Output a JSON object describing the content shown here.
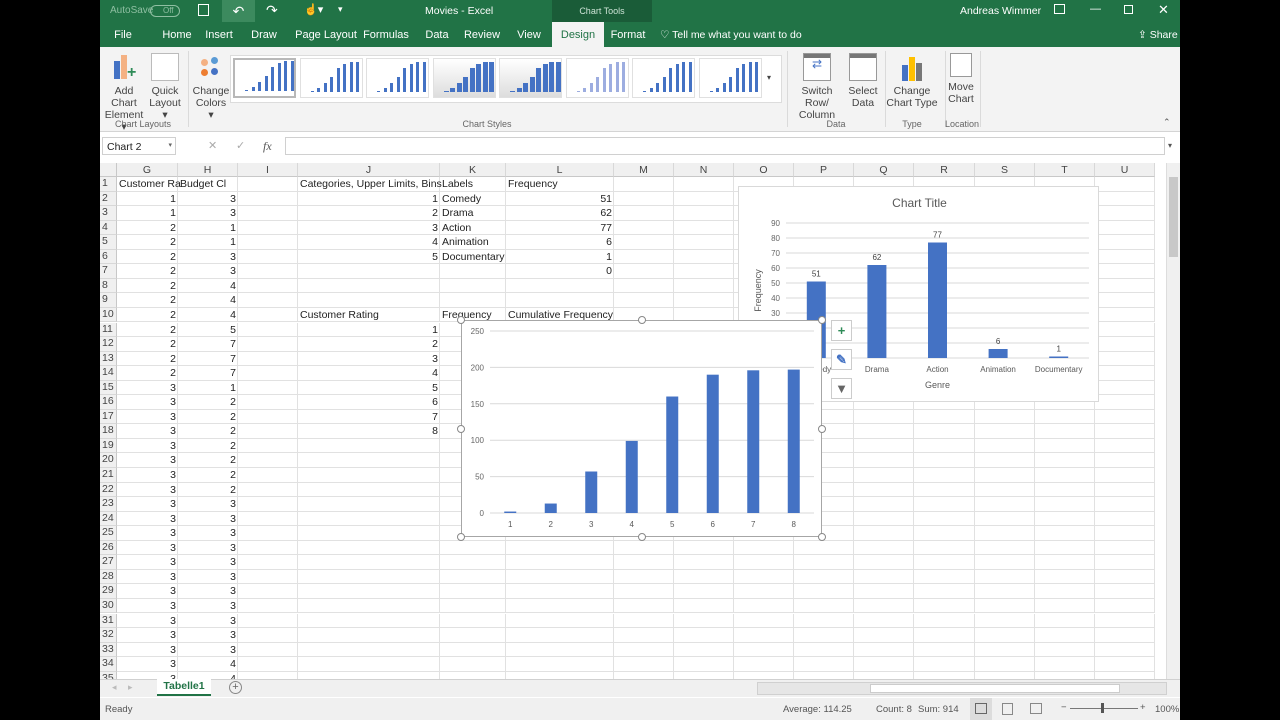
{
  "titlebar": {
    "autosave_label": "AutoSave",
    "autosave_state": "Off",
    "doc_title": "Movies  -  Excel",
    "context_tab_group": "Chart Tools",
    "user": "Andreas Wimmer"
  },
  "tabs": [
    {
      "label": "File"
    },
    {
      "label": "Home"
    },
    {
      "label": "Insert"
    },
    {
      "label": "Draw"
    },
    {
      "label": "Page Layout"
    },
    {
      "label": "Formulas"
    },
    {
      "label": "Data"
    },
    {
      "label": "Review"
    },
    {
      "label": "View"
    },
    {
      "label": "Design",
      "active": true
    },
    {
      "label": "Format"
    }
  ],
  "tell_me": "Tell me what you want to do",
  "share": "Share",
  "ribbon": {
    "add_chart_element": [
      "Add Chart",
      "Element ▾"
    ],
    "quick_layout": [
      "Quick",
      "Layout ▾"
    ],
    "change_colors": [
      "Change",
      "Colors ▾"
    ],
    "switch_row_column": [
      "Switch Row/",
      "Column"
    ],
    "select_data": [
      "Select",
      "Data"
    ],
    "change_chart_type": [
      "Change",
      "Chart Type"
    ],
    "move_chart": [
      "Move",
      "Chart"
    ],
    "groups": {
      "chart_layouts": "Chart Layouts",
      "chart_styles": "Chart Styles",
      "data": "Data",
      "type": "Type",
      "location": "Location"
    },
    "chart_style_count": 8,
    "accent": "#217346"
  },
  "formula_bar": {
    "name_box": "Chart 2",
    "cancel": "✕",
    "enter": "✓",
    "fx": "fx",
    "value": ""
  },
  "grid": {
    "columns": [
      "G",
      "H",
      "I",
      "J",
      "K",
      "L",
      "M",
      "N",
      "O",
      "P",
      "Q",
      "R",
      "S",
      "T",
      "U"
    ],
    "row_count": 35,
    "header_row": {
      "G": "Customer Ra",
      "H": "Budget Cl",
      "J": "Categories, Upper Limits, Bins",
      "K": "Labels",
      "L": "Frequency"
    },
    "G": [
      1,
      1,
      2,
      2,
      2,
      2,
      2,
      2,
      2,
      2,
      2,
      2,
      2,
      3,
      3,
      3,
      3,
      3,
      3,
      3,
      3,
      3,
      3,
      3,
      3,
      3,
      3,
      3,
      3,
      3,
      3,
      3,
      3,
      3
    ],
    "H": [
      3,
      3,
      1,
      1,
      3,
      3,
      4,
      4,
      4,
      5,
      7,
      7,
      7,
      1,
      2,
      2,
      2,
      2,
      2,
      2,
      2,
      3,
      3,
      3,
      3,
      3,
      3,
      3,
      3,
      3,
      3,
      3,
      4,
      4
    ],
    "J_bins": [
      1,
      2,
      3,
      4,
      5
    ],
    "K_labels": [
      "Comedy",
      "Drama",
      "Action",
      "Animation",
      "Documentary"
    ],
    "L_freq": [
      51,
      62,
      77,
      6,
      1,
      0
    ],
    "row10": {
      "J": "Customer Rating",
      "K": "Frequency",
      "L": "Cumulative Frequency"
    },
    "J_ratings": [
      1,
      2,
      3,
      4,
      5,
      6,
      7,
      8
    ]
  },
  "chart_data": [
    {
      "type": "bar",
      "title": "Chart Title",
      "categories": [
        "Comedy",
        "Drama",
        "Action",
        "Animation",
        "Documentary"
      ],
      "values": [
        51,
        62,
        77,
        6,
        1
      ],
      "data_labels": true,
      "xlabel": "Genre",
      "ylabel": "Frequency",
      "ylim": [
        0,
        90
      ],
      "yticks": [
        0,
        10,
        20,
        30,
        40,
        50,
        60,
        70,
        80,
        90
      ],
      "grid": true,
      "color": "#4472c4"
    },
    {
      "type": "bar",
      "title": "",
      "categories": [
        "1",
        "2",
        "3",
        "4",
        "5",
        "6",
        "7",
        "8"
      ],
      "values": [
        2,
        13,
        57,
        99,
        160,
        190,
        196,
        197
      ],
      "xlabel": "",
      "ylabel": "",
      "ylim": [
        0,
        250
      ],
      "yticks": [
        0,
        50,
        100,
        150,
        200,
        250
      ],
      "grid": true,
      "color": "#4472c4",
      "selected": true
    }
  ],
  "chart_buttons": [
    "chart-elements",
    "chart-styles",
    "chart-filters"
  ],
  "sheets": [
    {
      "label": "Tabelle1",
      "active": true
    }
  ],
  "status": {
    "ready": "Ready",
    "average": "Average: 114.25",
    "count": "Count: 8",
    "sum": "Sum: 914",
    "zoom": "100%",
    "zoom_minus": "−",
    "zoom_plus": "+"
  }
}
